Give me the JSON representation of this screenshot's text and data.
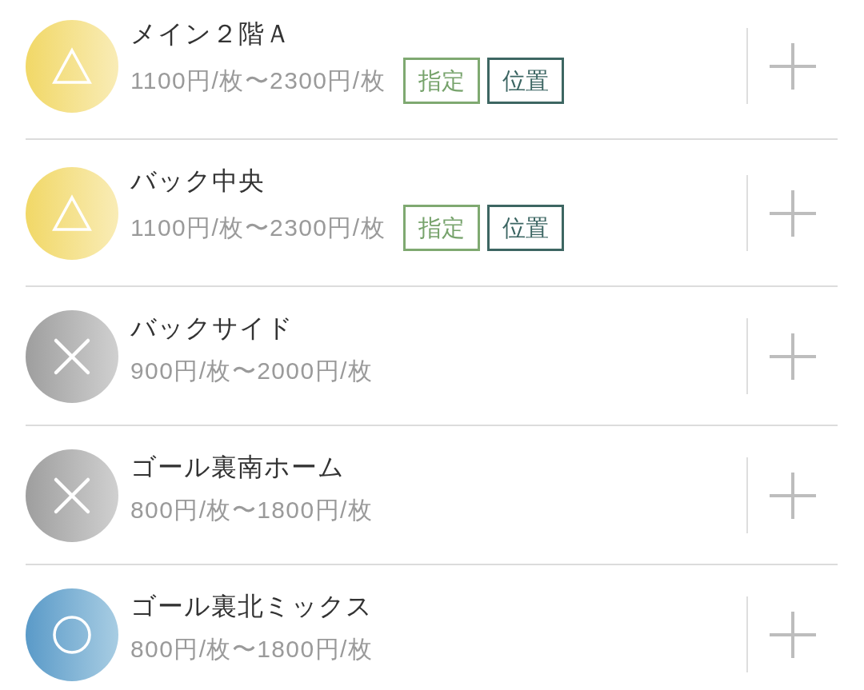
{
  "seat_areas": [
    {
      "name": "メイン２階Ａ",
      "kind": "limited",
      "price": "1100円/枚〜2300円/枚",
      "tags": [
        {
          "label": "指定",
          "kind": "reserved"
        },
        {
          "label": "位置",
          "kind": "location"
        }
      ]
    },
    {
      "name": "バック中央",
      "kind": "limited",
      "price": "1100円/枚〜2300円/枚",
      "tags": [
        {
          "label": "指定",
          "kind": "reserved"
        },
        {
          "label": "位置",
          "kind": "location"
        }
      ]
    },
    {
      "name": "バックサイド",
      "kind": "soldout",
      "price": "900円/枚〜2000円/枚"
    },
    {
      "name": "ゴール裏南ホーム",
      "kind": "soldout",
      "price": "800円/枚〜1800円/枚"
    },
    {
      "name": "ゴール裏北ミックス",
      "kind": "available",
      "price": "800円/枚〜1800円/枚"
    }
  ]
}
